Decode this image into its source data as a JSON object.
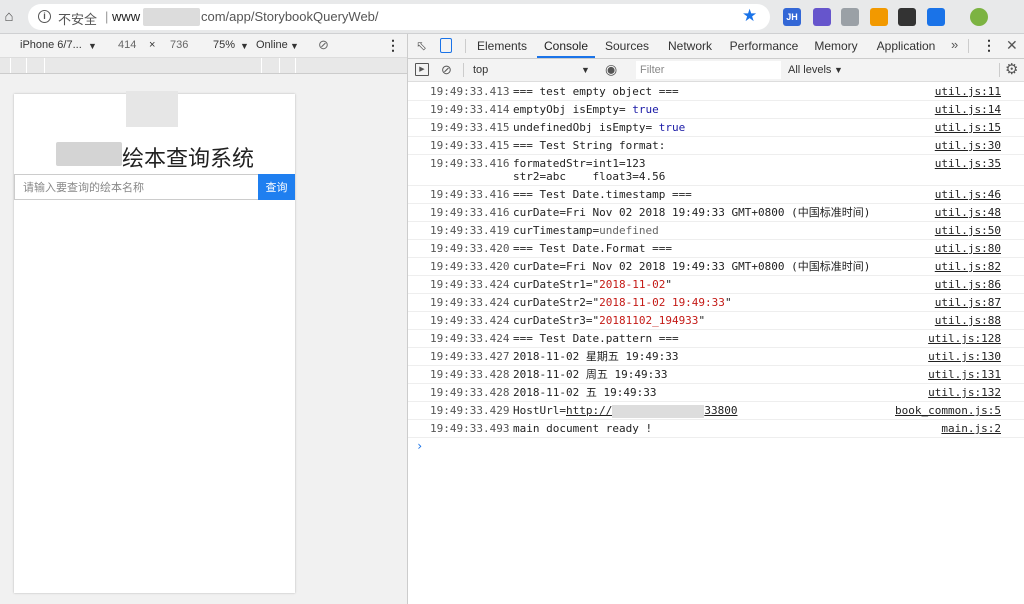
{
  "browser": {
    "not_secure": "不安全",
    "url_prefix": "www",
    "url_suffix": "com/app/StorybookQueryWeb/",
    "extensions": [
      {
        "name": "JH",
        "color": "#3367d6"
      },
      {
        "name": "ext-2",
        "color": "#6655cc"
      },
      {
        "name": "ext-3",
        "color": "#9aa0a6"
      },
      {
        "name": "ext-4",
        "color": "#f29900"
      },
      {
        "name": "ext-5",
        "color": "#333333"
      },
      {
        "name": "ext-6",
        "color": "#1a73e8"
      },
      {
        "name": "ext-7",
        "color": "#7cb342"
      }
    ]
  },
  "device_toolbar": {
    "device": "iPhone 6/7...",
    "width": "414",
    "times": "×",
    "height": "736",
    "zoom": "75%",
    "network": "Online"
  },
  "app": {
    "title": "绘本查询系统",
    "search_placeholder": "请输入要查询的绘本名称",
    "search_button": "查询"
  },
  "devtools": {
    "tabs": [
      "Elements",
      "Console",
      "Sources",
      "Network",
      "Performance",
      "Memory",
      "Application"
    ],
    "active_tab": "Console",
    "context": "top",
    "filter_placeholder": "Filter",
    "levels": "All levels"
  },
  "console": {
    "entries": [
      {
        "time": "19:49:33.413",
        "parts": [
          {
            "t": "=== test empty object ==="
          }
        ],
        "src": "util.js:11"
      },
      {
        "time": "19:49:33.414",
        "parts": [
          {
            "t": "emptyObj isEmpty= "
          },
          {
            "t": "true",
            "c": "kw"
          }
        ],
        "src": "util.js:14"
      },
      {
        "time": "19:49:33.415",
        "parts": [
          {
            "t": "undefinedObj isEmpty= "
          },
          {
            "t": "true",
            "c": "kw"
          }
        ],
        "src": "util.js:15"
      },
      {
        "time": "19:49:33.415",
        "parts": [
          {
            "t": "=== Test String format:"
          }
        ],
        "src": "util.js:30"
      },
      {
        "time": "19:49:33.416",
        "parts": [
          {
            "t": "formatedStr=int1=123\nstr2=abc    float3=4.56"
          }
        ],
        "src": "util.js:35"
      },
      {
        "time": "19:49:33.416",
        "parts": [
          {
            "t": "=== Test Date.timestamp ==="
          }
        ],
        "src": "util.js:46"
      },
      {
        "time": "19:49:33.416",
        "parts": [
          {
            "t": "curDate=Fri Nov 02 2018 19:49:33 GMT+0800 (中国标准时间)"
          }
        ],
        "src": "util.js:48"
      },
      {
        "time": "19:49:33.419",
        "parts": [
          {
            "t": "curTimestamp="
          },
          {
            "t": "undefined",
            "c": "udf"
          }
        ],
        "src": "util.js:50"
      },
      {
        "time": "19:49:33.420",
        "parts": [
          {
            "t": "=== Test Date.Format ==="
          }
        ],
        "src": "util.js:80"
      },
      {
        "time": "19:49:33.420",
        "parts": [
          {
            "t": "curDate=Fri Nov 02 2018 19:49:33 GMT+0800 (中国标准时间)"
          }
        ],
        "src": "util.js:82"
      },
      {
        "time": "19:49:33.424",
        "parts": [
          {
            "t": "curDateStr1=\""
          },
          {
            "t": "2018-11-02",
            "c": "str"
          },
          {
            "t": "\""
          }
        ],
        "src": "util.js:86"
      },
      {
        "time": "19:49:33.424",
        "parts": [
          {
            "t": "curDateStr2=\""
          },
          {
            "t": "2018-11-02 19:49:33",
            "c": "str"
          },
          {
            "t": "\""
          }
        ],
        "src": "util.js:87"
      },
      {
        "time": "19:49:33.424",
        "parts": [
          {
            "t": "curDateStr3=\""
          },
          {
            "t": "20181102_194933",
            "c": "str"
          },
          {
            "t": "\""
          }
        ],
        "src": "util.js:88"
      },
      {
        "time": "19:49:33.424",
        "parts": [
          {
            "t": "=== Test Date.pattern ==="
          }
        ],
        "src": "util.js:128"
      },
      {
        "time": "19:49:33.427",
        "parts": [
          {
            "t": "2018-11-02 星期五 19:49:33"
          }
        ],
        "src": "util.js:130"
      },
      {
        "time": "19:49:33.428",
        "parts": [
          {
            "t": "2018-11-02 周五 19:49:33"
          }
        ],
        "src": "util.js:131"
      },
      {
        "time": "19:49:33.428",
        "parts": [
          {
            "t": "2018-11-02 五 19:49:33"
          }
        ],
        "src": "util.js:132"
      },
      {
        "time": "19:49:33.429",
        "parts": [
          {
            "t": "HostUrl="
          },
          {
            "t": "http://",
            "c": "lnk"
          },
          {
            "t": "",
            "c": "blur"
          },
          {
            "t": "33800",
            "c": "lnk"
          }
        ],
        "src": "book_common.js:5"
      },
      {
        "time": "19:49:33.493",
        "parts": [
          {
            "t": "main document ready !"
          }
        ],
        "src": "main.js:2"
      }
    ],
    "prompt": "›"
  }
}
